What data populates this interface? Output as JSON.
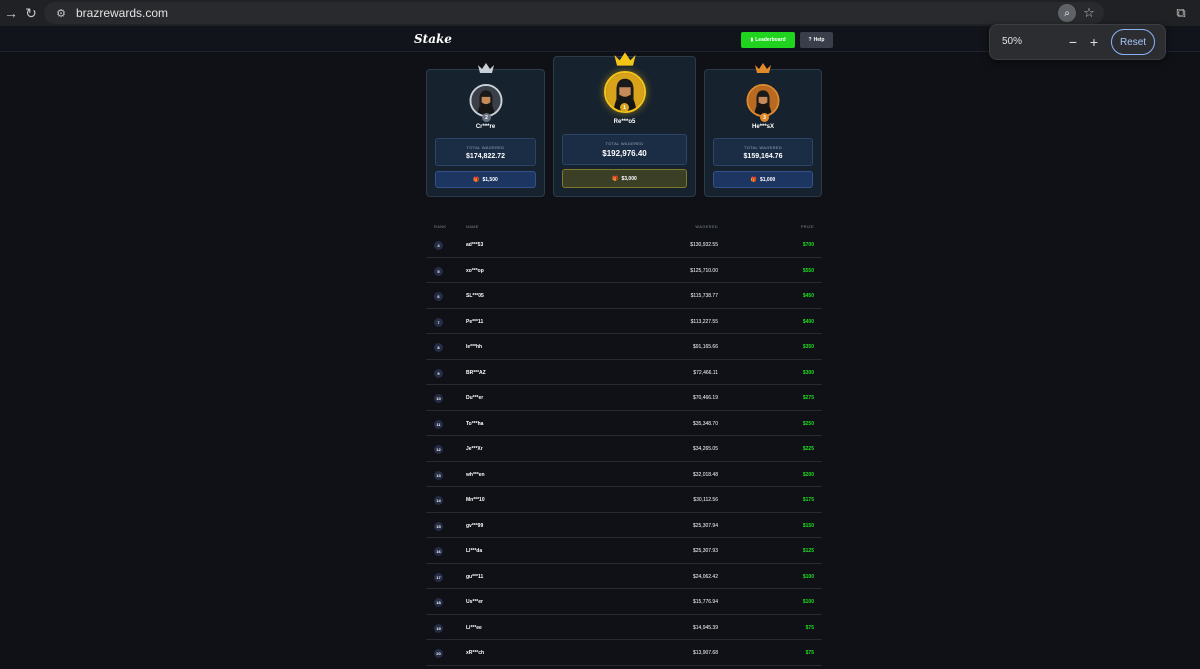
{
  "browser": {
    "url": "brazrewards.com",
    "zoom_indicator_icon": "magnifier-icon",
    "zoom_popup": {
      "percent": "50%",
      "minus": "−",
      "plus": "+",
      "reset": "Reset"
    }
  },
  "header": {
    "logo": "Stake",
    "leaderboard_label": "Leaderboard",
    "help_label": "Help",
    "accent": "#1fd31f"
  },
  "podium": [
    {
      "place": "2",
      "name": "Cr***re",
      "wagered_label": "TOTAL WAGERED",
      "wagered": "$174,822.72",
      "prize": "$1,500",
      "crown_color": "#c9cfd6"
    },
    {
      "place": "1",
      "name": "Re***o5",
      "wagered_label": "TOTAL WAGERED",
      "wagered": "$192,976.40",
      "prize": "$3,000",
      "crown_color": "#f5c518"
    },
    {
      "place": "3",
      "name": "He***sX",
      "wagered_label": "TOTAL WAGERED",
      "wagered": "$159,164.76",
      "prize": "$1,000",
      "crown_color": "#e08a2c"
    }
  ],
  "table": {
    "columns": {
      "rank": "RANK",
      "name": "NAME",
      "wagered": "WAGERED",
      "prize": "PRIZE"
    },
    "rows": [
      {
        "rank": "4",
        "name": "ad***53",
        "wagered": "$130,932.55",
        "prize": "$700"
      },
      {
        "rank": "5",
        "name": "xo***op",
        "wagered": "$125,710.00",
        "prize": "$550"
      },
      {
        "rank": "6",
        "name": "SL***05",
        "wagered": "$115,738.77",
        "prize": "$450"
      },
      {
        "rank": "7",
        "name": "Pe***11",
        "wagered": "$113,227.55",
        "prize": "$400"
      },
      {
        "rank": "8",
        "name": "le***hh",
        "wagered": "$91,165.66",
        "prize": "$350"
      },
      {
        "rank": "9",
        "name": "BR***AZ",
        "wagered": "$72,466.11",
        "prize": "$300"
      },
      {
        "rank": "10",
        "name": "Du***er",
        "wagered": "$70,466.19",
        "prize": "$275"
      },
      {
        "rank": "11",
        "name": "To***ha",
        "wagered": "$35,348.70",
        "prize": "$250"
      },
      {
        "rank": "12",
        "name": "Je***Xr",
        "wagered": "$34,265.05",
        "prize": "$225"
      },
      {
        "rank": "13",
        "name": "wh***en",
        "wagered": "$32,018.48",
        "prize": "$200"
      },
      {
        "rank": "14",
        "name": "Mn***10",
        "wagered": "$30,112.56",
        "prize": "$175"
      },
      {
        "rank": "15",
        "name": "gv***99",
        "wagered": "$25,307.94",
        "prize": "$150"
      },
      {
        "rank": "16",
        "name": "Ll***da",
        "wagered": "$25,307.93",
        "prize": "$125"
      },
      {
        "rank": "17",
        "name": "gu***11",
        "wagered": "$24,062.42",
        "prize": "$100"
      },
      {
        "rank": "18",
        "name": "Us***er",
        "wagered": "$15,776.94",
        "prize": "$100"
      },
      {
        "rank": "19",
        "name": "Li***ee",
        "wagered": "$14,945.39",
        "prize": "$75"
      },
      {
        "rank": "20",
        "name": "xR***ch",
        "wagered": "$13,907.68",
        "prize": "$75"
      }
    ]
  }
}
